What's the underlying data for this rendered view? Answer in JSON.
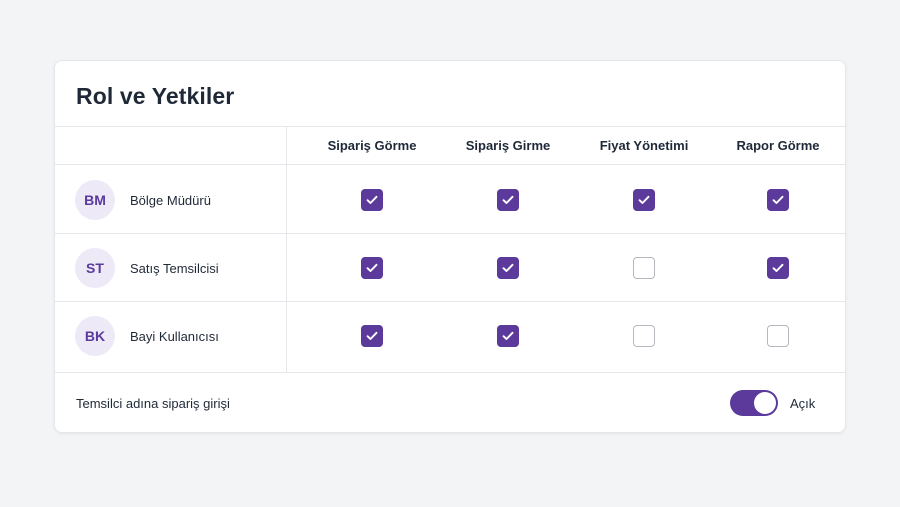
{
  "card": {
    "title": "Rol ve Yetkiler"
  },
  "columns": [
    "Sipariş Görme",
    "Sipariş Girme",
    "Fiyat Yönetimi",
    "Rapor Görme"
  ],
  "roles": [
    {
      "initials": "BM",
      "name": "Bölge Müdürü",
      "permissions": [
        true,
        true,
        true,
        true
      ]
    },
    {
      "initials": "ST",
      "name": "Satış Temsilcisi",
      "permissions": [
        true,
        true,
        false,
        true
      ]
    },
    {
      "initials": "BK",
      "name": "Bayi Kullanıcısı",
      "permissions": [
        true,
        true,
        false,
        false
      ]
    }
  ],
  "footer": {
    "label": "Temsilci adına sipariş girişi",
    "toggle_on": true,
    "toggle_label": "Açık"
  },
  "colors": {
    "accent": "#5b3a9c",
    "avatar_bg": "#ede9f7",
    "unchecked_border": "#b5b8be",
    "background": "#f3f4f6"
  },
  "icons": {
    "checked": "check-icon"
  }
}
